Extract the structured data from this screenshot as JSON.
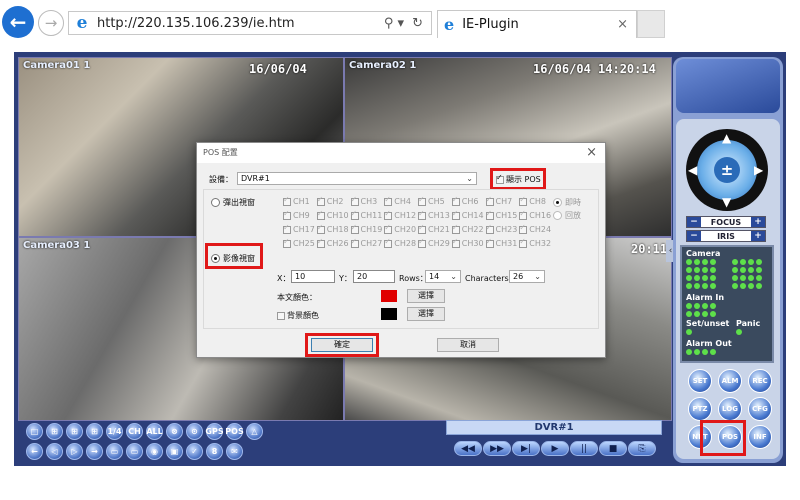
{
  "browser": {
    "url": "http://220.135.106.239/ie.htm",
    "tab_title": "IE-Plugin",
    "tab_close": "×",
    "search_icon": "search-icon",
    "refresh_icon": "refresh-icon"
  },
  "viewer": {
    "cameras": [
      {
        "label": "Camera01 1",
        "timestamp": "16/06/04"
      },
      {
        "label": "Camera02 1",
        "timestamp": "16/06/04 14:20:14"
      },
      {
        "label": "Camera03 1",
        "timestamp": ""
      },
      {
        "label": "",
        "timestamp": "20:11"
      }
    ],
    "dvr_label": "DVR#1",
    "toolbar_row1": [
      "□",
      "⊞",
      "⊞",
      "⊞",
      "1/4",
      "CH",
      "ALL",
      "⊗",
      "⊙",
      "GPS",
      "POS",
      "△"
    ],
    "toolbar_row2": [
      "←",
      "◁",
      "▷",
      "→",
      "▭",
      "▭",
      "◉",
      "▣",
      "✓",
      "8",
      "✉"
    ],
    "playback": [
      "◀◀",
      "▶▶",
      "▶|",
      "▶",
      "||",
      "■",
      "⎘"
    ]
  },
  "panel": {
    "focus": "FOCUS",
    "iris": "IRIS",
    "status": {
      "camera": "Camera",
      "alarm_in": "Alarm In",
      "set_unset": "Set/unset",
      "panic": "Panic",
      "alarm_out": "Alarm Out"
    },
    "func_buttons": [
      "SET",
      "ALM",
      "REC",
      "PTZ",
      "LOG",
      "CFG",
      "NET",
      "POS",
      "INF"
    ]
  },
  "dialog": {
    "title": "POS 配置",
    "device_label": "設備：",
    "device_value": "DVR#1",
    "show_pos_label": "顯示 POS",
    "show_pos_checked": true,
    "popup_label": "彈出視窗",
    "video_label": "影像視窗",
    "selected_mode": "影像視窗",
    "channels": [
      "CH1",
      "CH2",
      "CH3",
      "CH4",
      "CH5",
      "CH6",
      "CH7",
      "CH8",
      "CH9",
      "CH10",
      "CH11",
      "CH12",
      "CH13",
      "CH14",
      "CH15",
      "CH16",
      "CH17",
      "CH18",
      "CH19",
      "CH20",
      "CH21",
      "CH22",
      "CH23",
      "CH24",
      "CH25",
      "CH26",
      "CH27",
      "CH28",
      "CH29",
      "CH30",
      "CH31",
      "CH32"
    ],
    "realtime_label": "即時",
    "playback_label": "回放",
    "x_label": "X：",
    "x_value": "10",
    "y_label": "Y：",
    "y_value": "20",
    "rows_label": "Rows：",
    "rows_value": "14",
    "chars_label": "Characters：",
    "chars_value": "26",
    "text_color_label": "本文顏色：",
    "text_color": "#e00000",
    "bg_color_label": "背景顏色",
    "bg_color": "#000000",
    "select_button": "選擇",
    "ok_button": "確定",
    "cancel_button": "取消"
  }
}
